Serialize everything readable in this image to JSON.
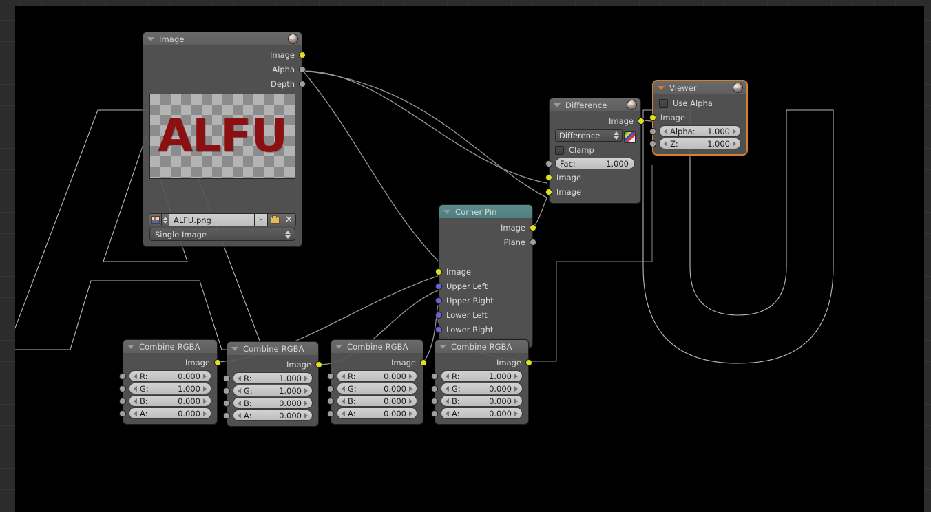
{
  "editor": {
    "name": "node-compositor",
    "background_color": "#2c2c2c",
    "backdrop_color": "#000000"
  },
  "nodes": {
    "image": {
      "title": "Image",
      "outputs": [
        {
          "label": "Image",
          "socket": "image"
        },
        {
          "label": "Alpha",
          "socket": "value"
        },
        {
          "label": "Depth",
          "socket": "value"
        }
      ],
      "preview_text": "ALFU",
      "filename": "ALFU.png",
      "f_label": "F",
      "source": "Single Image"
    },
    "difference": {
      "title": "Difference",
      "output_label": "Image",
      "blend_mode": "Difference",
      "clamp_label": "Clamp",
      "fac_label": "Fac:",
      "fac_value": "1.000",
      "input1_label": "Image",
      "input2_label": "Image"
    },
    "viewer": {
      "title": "Viewer",
      "use_alpha_label": "Use Alpha",
      "image_label": "Image",
      "alpha_label": "Alpha:",
      "alpha_value": "1.000",
      "z_label": "Z:",
      "z_value": "1.000",
      "selected": true,
      "select_color": "#d08030"
    },
    "corner_pin": {
      "title": "Corner Pin",
      "header_color": "#54807f",
      "outputs": [
        {
          "label": "Image",
          "socket": "image"
        },
        {
          "label": "Plane",
          "socket": "value"
        }
      ],
      "inputs": [
        {
          "label": "Image",
          "socket": "image"
        },
        {
          "label": "Upper Left",
          "socket": "vector"
        },
        {
          "label": "Upper Right",
          "socket": "vector"
        },
        {
          "label": "Lower Left",
          "socket": "vector"
        },
        {
          "label": "Lower Right",
          "socket": "vector"
        }
      ]
    },
    "combine_rgba": [
      {
        "title": "Combine RGBA",
        "output_label": "Image",
        "fields": [
          {
            "label": "R:",
            "value": "0.000"
          },
          {
            "label": "G:",
            "value": "1.000"
          },
          {
            "label": "B:",
            "value": "0.000"
          },
          {
            "label": "A:",
            "value": "0.000"
          }
        ]
      },
      {
        "title": "Combine RGBA",
        "output_label": "Image",
        "fields": [
          {
            "label": "R:",
            "value": "1.000"
          },
          {
            "label": "G:",
            "value": "1.000"
          },
          {
            "label": "B:",
            "value": "0.000"
          },
          {
            "label": "A:",
            "value": "0.000"
          }
        ]
      },
      {
        "title": "Combine RGBA",
        "output_label": "Image",
        "fields": [
          {
            "label": "R:",
            "value": "0.000"
          },
          {
            "label": "G:",
            "value": "0.000"
          },
          {
            "label": "B:",
            "value": "0.000"
          },
          {
            "label": "A:",
            "value": "0.000"
          }
        ]
      },
      {
        "title": "Combine RGBA",
        "output_label": "Image",
        "fields": [
          {
            "label": "R:",
            "value": "1.000"
          },
          {
            "label": "G:",
            "value": "0.000"
          },
          {
            "label": "B:",
            "value": "0.000"
          },
          {
            "label": "A:",
            "value": "0.000"
          }
        ]
      }
    ]
  },
  "socket_colors": {
    "image": "#e0e01e",
    "value": "#9f9f9f",
    "vector": "#6a63e0"
  }
}
